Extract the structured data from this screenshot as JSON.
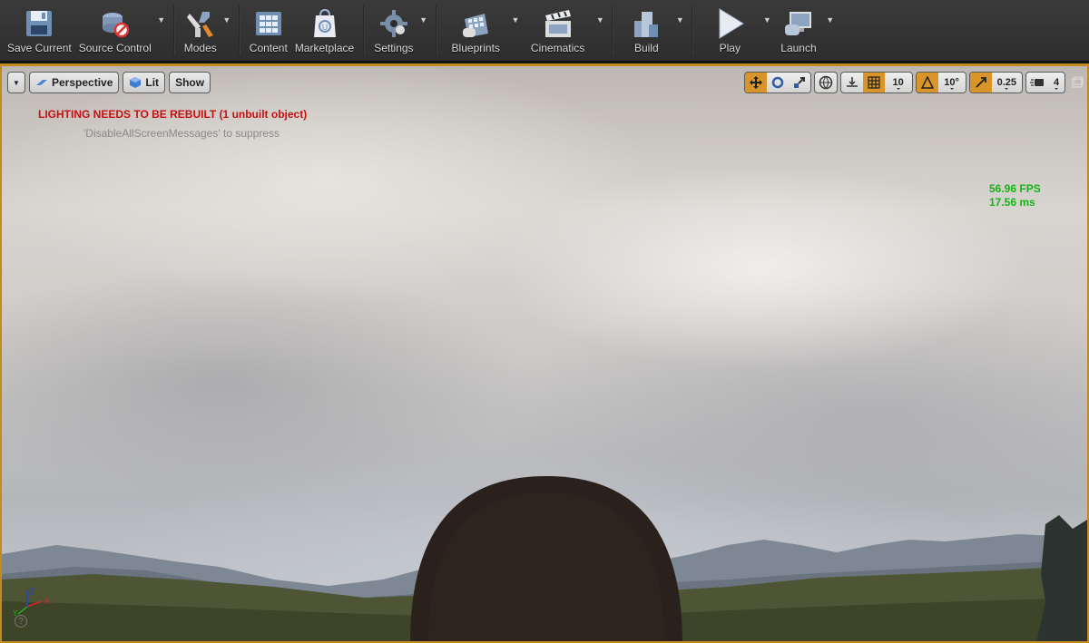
{
  "toolbar": {
    "save_current": "Save Current",
    "source_control": "Source Control",
    "modes": "Modes",
    "content": "Content",
    "marketplace": "Marketplace",
    "settings": "Settings",
    "blueprints": "Blueprints",
    "cinematics": "Cinematics",
    "build": "Build",
    "play": "Play",
    "launch": "Launch"
  },
  "viewport": {
    "view_mode": "Perspective",
    "lighting_mode": "Lit",
    "show_label": "Show",
    "grid_snap": "10",
    "rotation_snap": "10°",
    "scale_snap": "0.25",
    "camera_speed": "4",
    "warning": "LIGHTING NEEDS TO BE REBUILT (1 unbuilt object)",
    "hint": "'DisableAllScreenMessages' to suppress",
    "fps": "56.96 FPS",
    "frame_ms": "17.56 ms",
    "axis_x": "X",
    "axis_y": "Y",
    "axis_z": "Z"
  },
  "colors": {
    "accent": "#c58a1f",
    "warning_text": "#c41010",
    "fps_text": "#15b315"
  },
  "icons": [
    "save-icon",
    "source-control-icon",
    "modes-icon",
    "content-icon",
    "marketplace-icon",
    "settings-icon",
    "blueprints-icon",
    "cinematics-icon",
    "build-icon",
    "play-icon",
    "launch-icon"
  ]
}
